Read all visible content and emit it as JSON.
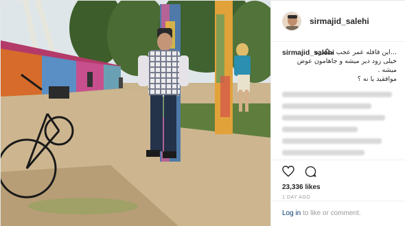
{
  "post": {
    "username": "sirmajid_salehi",
    "caption": {
      "username": "sirmajid_salehi",
      "lines": [
        "...این قافله عمر عجب میگذره",
        "خیلی زود دیر میشه و جاهامون عوض میشه .",
        "موافقید یا نه ؟"
      ]
    },
    "likes": "23,336 likes",
    "timestamp": "1 DAY AGO",
    "login_link": "Log in",
    "login_text": " to like or comment."
  },
  "icons": {
    "like": "heart-icon",
    "comment": "comment-icon"
  },
  "colors": {
    "link": "#003569",
    "muted": "#999999",
    "border": "#efefef"
  }
}
